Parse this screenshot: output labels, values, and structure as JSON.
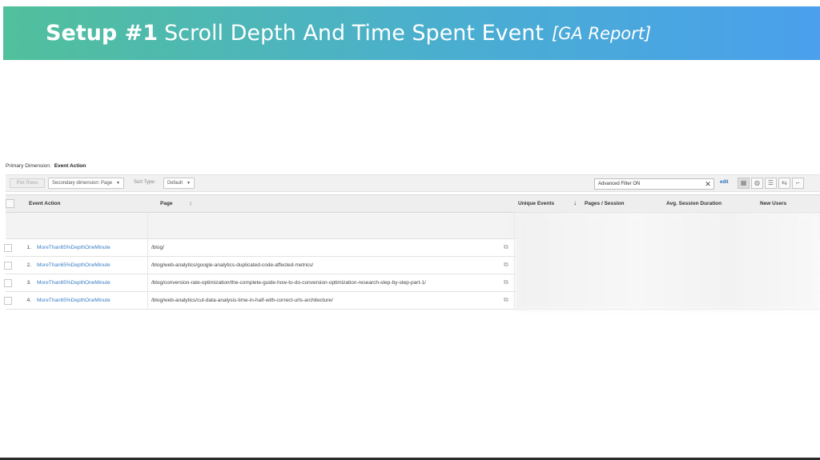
{
  "slide": {
    "title_bold": "Setup #1",
    "title_rest": "Scroll Depth And Time Spent Event",
    "title_italic": "[GA Report]",
    "gradient_start": "#51c09b",
    "gradient_end": "#4aa0ec"
  },
  "report": {
    "primary_dimension_label": "Primary Dimension:",
    "primary_dimension_value": "Event Action",
    "toolbar": {
      "plot_rows_label": "Plot Rows",
      "secondary_dimension": "Secondary dimension: Page",
      "sort_type_label": "Sort Type:",
      "sort_type_value": "Default",
      "filter_value": "Advanced Filter ON",
      "clear_symbol": "✕",
      "edit_label": "edit",
      "view_icons": [
        "table-view-icon",
        "pie-view-icon",
        "performance-view-icon",
        "comparison-view-icon",
        "pivot-view-icon"
      ]
    },
    "columns": {
      "event_action": "Event Action",
      "page": "Page",
      "unique_events": "Unique Events",
      "pages_session": "Pages / Session",
      "avg_session_duration": "Avg. Session Duration",
      "new_users": "New Users"
    },
    "rows": [
      {
        "num": "1.",
        "action": "MoreThan65%DepthOneMinute",
        "page": "/blog/"
      },
      {
        "num": "2.",
        "action": "MoreThan65%DepthOneMinute",
        "page": "/blog/web-analytics/google-analytics-duplicated-code-affected-metrics/"
      },
      {
        "num": "3.",
        "action": "MoreThan65%DepthOneMinute",
        "page": "/blog/conversion-rate-optimization/the-complete-guide-how-to-do-conversion-optimization-research-step-by-step-part-1/"
      },
      {
        "num": "4.",
        "action": "MoreThan65%DepthOneMinute",
        "page": "/blog/web-analytics/cut-data-analysis-time-in-half-with-correct-urls-architecture/"
      }
    ],
    "link_color": "#3b7dc6"
  }
}
